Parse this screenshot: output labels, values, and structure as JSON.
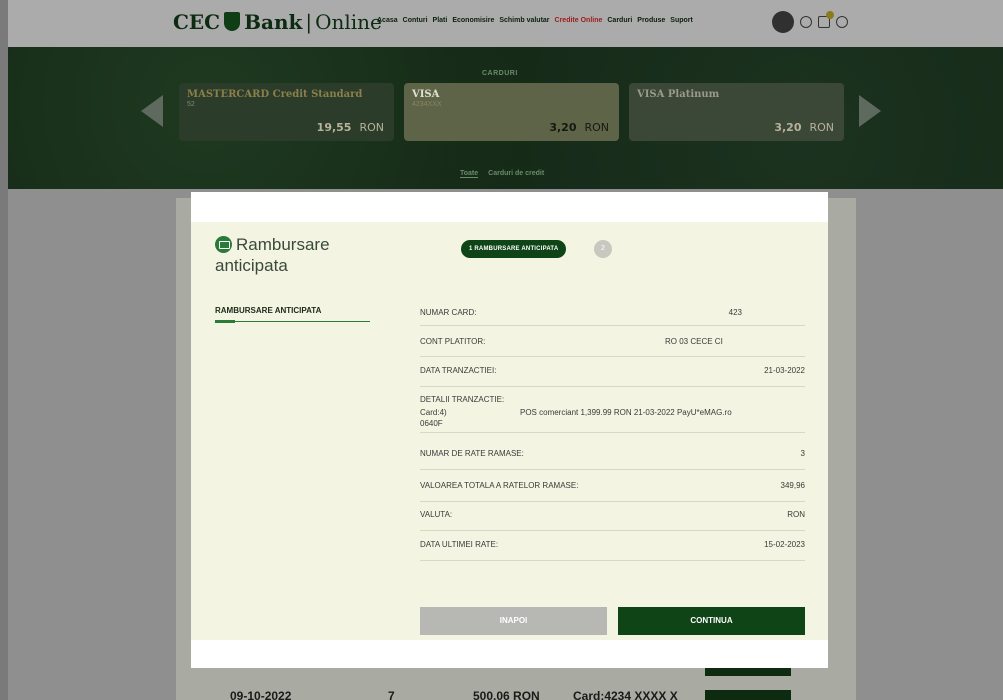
{
  "header": {
    "logo": {
      "cec": "CEC",
      "bank": "Bank",
      "sep": "|",
      "online": "Online"
    },
    "nav": [
      "Acasa",
      "Conturi",
      "Plati",
      "Economisire",
      "Schimb valutar",
      "Credite Online",
      "Carduri",
      "Produse",
      "Suport"
    ],
    "active_nav": "Credite Online",
    "notifications_badge": ""
  },
  "cards_section": {
    "title": "CARDURI",
    "cards": [
      {
        "name": "MASTERCARD Credit Standard",
        "number": "52",
        "amount": "19,55",
        "currency": "RON"
      },
      {
        "name": "VISA",
        "number": "4234XXX",
        "amount": "3,20",
        "currency": "RON"
      },
      {
        "name": "VISA Platinum",
        "number": "",
        "amount": "3,20",
        "currency": "RON"
      }
    ],
    "filters": [
      "Toate",
      "Carduri de credit"
    ]
  },
  "background_rows": [
    {
      "date": "09-10-2022",
      "count": "7",
      "amount": "500,06 RON",
      "card": "Card:4234 XXXX X"
    }
  ],
  "modal": {
    "title": "Rambursare anticipata",
    "steps": {
      "current": "1 RAMBURSARE ANTICIPATA",
      "next": "2"
    },
    "sidebar_item": "RAMBURSARE ANTICIPATA",
    "fields": {
      "numar_card": {
        "label": "NUMAR CARD:",
        "value": "423"
      },
      "cont_platitor": {
        "label": "CONT PLATITOR:",
        "value": "RO 03 CECE CI"
      },
      "data_tranzactiei": {
        "label": "DATA TRANZACTIEI:",
        "value": "21-03-2022"
      },
      "detalii": {
        "label": "DETALII TRANZACTIE:",
        "card": "Card:4)",
        "code": "0640F",
        "description": "POS comerciant 1,399.99 RON 21-03-2022 PayU*eMAG.ro"
      },
      "rate_ramase": {
        "label": "NUMAR DE RATE RAMASE:",
        "value": "3"
      },
      "valoare_totala": {
        "label": "VALOAREA TOTALA A RATELOR RAMASE:",
        "value": "349,96"
      },
      "valuta": {
        "label": "VALUTA:",
        "value": "RON"
      },
      "data_ultimei_rate": {
        "label": "DATA ULTIMEI RATE:",
        "value": "15-02-2023"
      }
    },
    "buttons": {
      "back": "INAPOI",
      "continue": "CONTINUA"
    }
  }
}
